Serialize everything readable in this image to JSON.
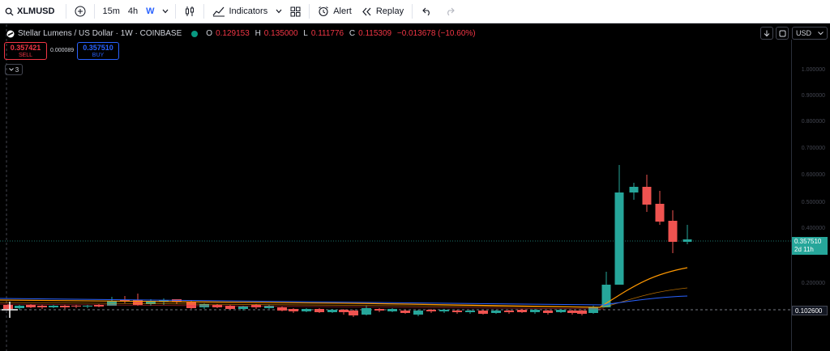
{
  "toolbar": {
    "symbol": "XLMUSD",
    "timeframes": [
      "15m",
      "4h",
      "W"
    ],
    "active_timeframe": "W",
    "indicators_label": "Indicators",
    "alert_label": "Alert",
    "replay_label": "Replay"
  },
  "legend": {
    "title": "Stellar Lumens / US Dollar · 1W · COINBASE",
    "o_label": "O",
    "o_value": "0.129153",
    "h_label": "H",
    "h_value": "0.135000",
    "l_label": "L",
    "l_value": "0.111776",
    "c_label": "C",
    "c_value": "0.115309",
    "change": "−0.013678 (−10.60%)"
  },
  "trade": {
    "sell_price": "0.357421",
    "sell_label": "SELL",
    "spread": "0.000089",
    "buy_price": "0.357510",
    "buy_label": "BUY"
  },
  "collapse_count": "3",
  "currency": "USD",
  "axis": {
    "labels": [
      "1.000000",
      "0.900000",
      "0.800000",
      "0.700000",
      "0.600000",
      "0.500000",
      "0.400000",
      "0.200000"
    ],
    "last_price": "0.357510",
    "countdown": "2d 11h",
    "crosshair_price": "0.102600"
  },
  "colors": {
    "up": "#26a69a",
    "down": "#ef5350",
    "ma_orange": "#ff9800",
    "ma_blue": "#2962ff",
    "ma_red": "#f23645"
  },
  "icons": {
    "search": "search-icon",
    "add": "add-symbol-icon",
    "chevron": "chevron-down-icon",
    "bars": "bars-style-icon",
    "indicators": "indicators-icon",
    "layout": "layout-grid-icon",
    "alert": "alarm-clock-icon",
    "replay": "replay-icon",
    "undo": "undo-icon",
    "redo": "redo-icon"
  }
}
